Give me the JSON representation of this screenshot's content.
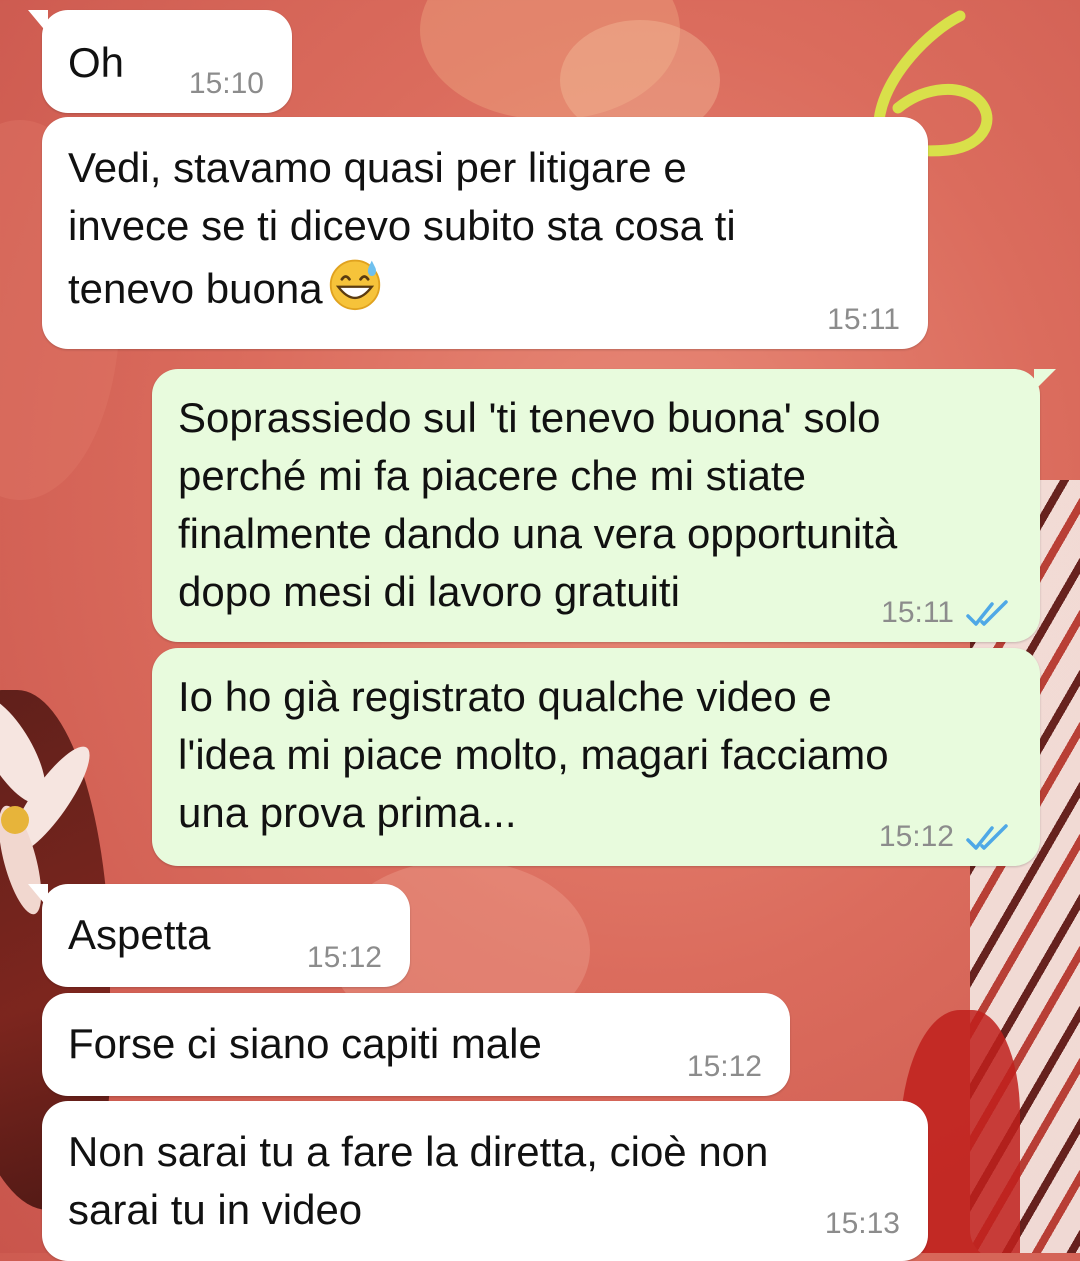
{
  "annotation": {
    "mark": "6",
    "color": "#d9e04a"
  },
  "colors": {
    "incoming_bubble": "#ffffff",
    "outgoing_bubble": "#e8fbdd",
    "timestamp": "#8c8c8c",
    "read_ticks": "#4fa8e6"
  },
  "messages": [
    {
      "direction": "incoming",
      "text": "Oh",
      "time": "15:10"
    },
    {
      "direction": "incoming",
      "text": "Vedi, stavamo quasi per litigare e\ninvece se ti dicevo subito sta cosa ti\ntenevo buona",
      "emoji": "grinning-face-with-sweat",
      "time": "15:11"
    },
    {
      "direction": "outgoing",
      "text": "Soprassiedo sul 'ti tenevo buona' solo\nperché mi fa piacere che mi stiate\nfinalmente dando una vera opportunità\ndopo mesi di lavoro gratuiti",
      "time": "15:11",
      "status": "read"
    },
    {
      "direction": "outgoing",
      "text": "Io ho già registrato qualche video e\nl'idea mi piace molto, magari facciamo\nuna prova prima...",
      "time": "15:12",
      "status": "read"
    },
    {
      "direction": "incoming",
      "text": "Aspetta",
      "time": "15:12"
    },
    {
      "direction": "incoming",
      "text": "Forse ci siano capiti male",
      "time": "15:12"
    },
    {
      "direction": "incoming",
      "text": "Non sarai tu a fare la diretta, cioè non\nsarai tu in video",
      "time": "15:13"
    }
  ]
}
